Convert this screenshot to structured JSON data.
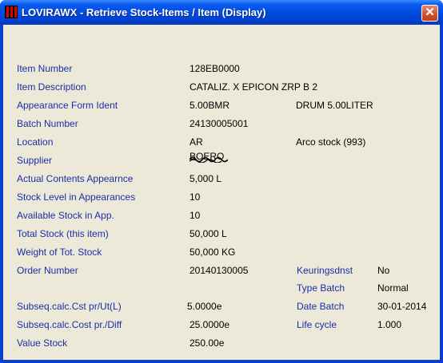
{
  "window": {
    "title": "LOVIRAWX - Retrieve Stock-Items / Item  (Display)",
    "close_label": "✕"
  },
  "fields": {
    "item_number": {
      "label": "Item Number",
      "value": "128EB0000"
    },
    "item_description": {
      "label": "Item Description",
      "value": "CATALIZ. X EPICON ZRP B 2"
    },
    "appearance_form_ident": {
      "label": "Appearance Form Ident",
      "value": "5.00BMR",
      "extra": "DRUM 5.00LITER"
    },
    "batch_number": {
      "label": "Batch Number",
      "value": "24130005001"
    },
    "location": {
      "label": "Location",
      "value": "AR",
      "extra": "Arco stock (993)"
    },
    "supplier": {
      "label": "Supplier",
      "value": "BOERO"
    },
    "actual_contents": {
      "label": "Actual Contents Appearnce",
      "value": "5,000 L"
    },
    "stock_level": {
      "label": "Stock Level in Appearances",
      "value": "10"
    },
    "available_stock": {
      "label": "Available Stock in App.",
      "value": "10"
    },
    "total_stock": {
      "label": "Total Stock (this item)",
      "value": "50,000 L"
    },
    "weight_total": {
      "label": "Weight of Tot. Stock",
      "value": "50,000 KG"
    },
    "order_number": {
      "label": "Order Number",
      "value": "20140130005"
    },
    "subseq_cst": {
      "label": "Subseq.calc.Cst pr/Ut(L)",
      "value": "5.0000e"
    },
    "subseq_cost_diff": {
      "label": "Subseq.calc.Cost pr./Diff",
      "value": "25.0000e"
    },
    "value_stock": {
      "label": "Value Stock",
      "value": "250.00e"
    }
  },
  "right_fields": {
    "keuringsdnst": {
      "label": "Keuringsdnst",
      "value": "No"
    },
    "type_batch": {
      "label": "Type Batch",
      "value": "Normal"
    },
    "date_batch": {
      "label": "Date Batch",
      "value": "30-01-2014"
    },
    "life_cycle": {
      "label": "Life cycle",
      "value": "1.000"
    }
  },
  "colors": {
    "titlebar": "#0049df",
    "client_bg": "#ece9d8",
    "label_text": "#1a2ea8",
    "close_button": "#d0502c"
  }
}
